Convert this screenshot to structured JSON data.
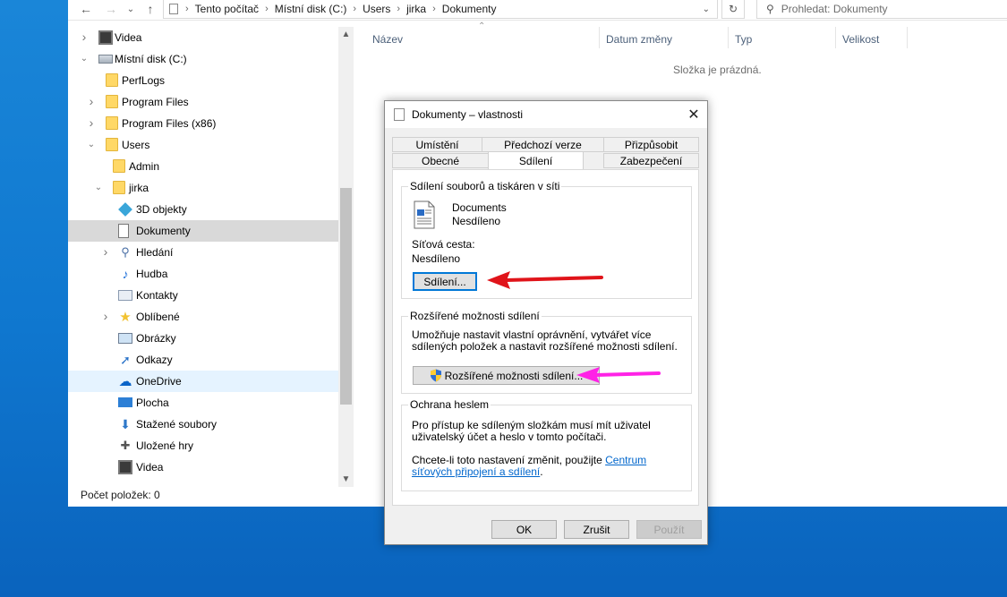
{
  "explorer": {
    "breadcrumb": [
      "Tento počítač",
      "Místní disk (C:)",
      "Users",
      "jirka",
      "Dokumenty"
    ],
    "search_placeholder": "Prohledat: Dokumenty",
    "columns": [
      "Název",
      "Datum změny",
      "Typ",
      "Velikost"
    ],
    "empty_message": "Složka je prázdná.",
    "status": "Počet položek: 0",
    "nav_items": [
      {
        "label": "Videa",
        "icon": "video-icon",
        "level": 0,
        "expander": "collapsed"
      },
      {
        "label": "Místní disk (C:)",
        "icon": "drive-icon",
        "level": 0,
        "expander": "expanded"
      },
      {
        "label": "PerfLogs",
        "icon": "folder-icon",
        "level": 1,
        "expander": "none"
      },
      {
        "label": "Program Files",
        "icon": "folder-icon",
        "level": 1,
        "expander": "collapsed"
      },
      {
        "label": "Program Files (x86)",
        "icon": "folder-icon",
        "level": 1,
        "expander": "collapsed"
      },
      {
        "label": "Users",
        "icon": "folder-icon",
        "level": 1,
        "expander": "expanded"
      },
      {
        "label": "Admin",
        "icon": "folder-icon",
        "level": 2,
        "expander": "none"
      },
      {
        "label": "jirka",
        "icon": "folder-icon",
        "level": 2,
        "expander": "expanded"
      },
      {
        "label": "3D objekty",
        "icon": "3d-objects-icon",
        "level": 3,
        "expander": "none"
      },
      {
        "label": "Dokumenty",
        "icon": "document-icon",
        "level": 3,
        "expander": "none",
        "selected": true
      },
      {
        "label": "Hledání",
        "icon": "search-icon",
        "level": 3,
        "expander": "collapsed"
      },
      {
        "label": "Hudba",
        "icon": "music-icon",
        "level": 3,
        "expander": "none"
      },
      {
        "label": "Kontakty",
        "icon": "contacts-icon",
        "level": 3,
        "expander": "none"
      },
      {
        "label": "Oblíbené",
        "icon": "star-icon",
        "level": 3,
        "expander": "collapsed"
      },
      {
        "label": "Obrázky",
        "icon": "pictures-icon",
        "level": 3,
        "expander": "none"
      },
      {
        "label": "Odkazy",
        "icon": "link-arrow-icon",
        "level": 3,
        "expander": "none"
      },
      {
        "label": "OneDrive",
        "icon": "cloud-icon",
        "level": 3,
        "expander": "none",
        "hover": true
      },
      {
        "label": "Plocha",
        "icon": "desktop-icon",
        "level": 3,
        "expander": "none"
      },
      {
        "label": "Stažené soubory",
        "icon": "download-icon",
        "level": 3,
        "expander": "none"
      },
      {
        "label": "Uložené hry",
        "icon": "games-icon",
        "level": 3,
        "expander": "none"
      },
      {
        "label": "Videa",
        "icon": "video-icon",
        "level": 3,
        "expander": "none"
      }
    ]
  },
  "dialog": {
    "title": "Dokumenty – vlastnosti",
    "tabs_row1": [
      "Umístění",
      "Předchozí verze",
      "Přizpůsobit"
    ],
    "tabs_row2": [
      "Obecné",
      "Sdílení",
      "Zabezpečení"
    ],
    "active_tab": "Sdílení",
    "sharing_group": {
      "label": "Sdílení souborů a tiskáren v síti",
      "item_name": "Documents",
      "item_status": "Nesdíleno",
      "path_label": "Síťová cesta:",
      "path_value": "Nesdíleno",
      "button": "Sdílení..."
    },
    "advanced_group": {
      "label": "Rozšířené možnosti sdílení",
      "description": "Umožňuje nastavit vlastní oprávnění, vytvářet více sdílených položek a nastavit rozšířené možnosti sdílení.",
      "button": "Rozšířené možnosti sdílení..."
    },
    "password_group": {
      "label": "Ochrana heslem",
      "description": "Pro přístup ke sdíleným složkám musí mít uživatel uživatelský účet a heslo v tomto počítači.",
      "change_text": "Chcete-li toto nastavení změnit, použijte ",
      "link_text": "Centrum síťových připojení a sdílení",
      "after_link": "."
    },
    "buttons": {
      "ok": "OK",
      "cancel": "Zrušit",
      "apply": "Použít"
    }
  },
  "colors": {
    "desktop": "#0f77cf",
    "selection": "#d9d9d9",
    "hover": "#e5f3ff",
    "red_arrow": "#e0141a",
    "magenta_arrow": "#ff22e6",
    "link": "#0066cc"
  }
}
